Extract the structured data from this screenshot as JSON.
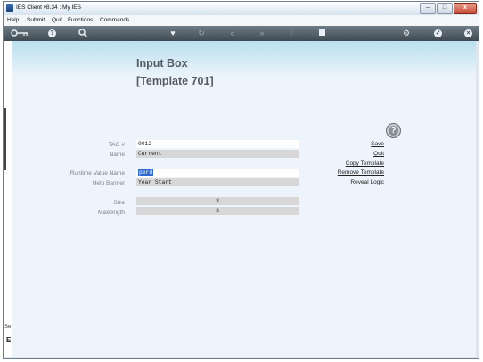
{
  "window": {
    "title": "IES Client v8.34 : My IES",
    "controls": {
      "minimize": "–",
      "maximize": "□",
      "close": "x"
    }
  },
  "menu": {
    "items": [
      "Help",
      "Submit",
      "Quit",
      "Functions",
      "Commands"
    ]
  },
  "toolbar": {
    "icons": [
      "key-icon",
      "help-icon",
      "search-icon",
      "heart-icon",
      "refresh-icon",
      "rewind-icon",
      "fast-forward-icon",
      "upload-icon",
      "stop-icon",
      "settings-icon",
      "check-icon",
      "close-icon"
    ]
  },
  "page": {
    "title": "Input Box",
    "subtitle": "[Template 701]"
  },
  "form": {
    "tag_label": "TAG #",
    "tag_value": "0012",
    "name_label": "Name",
    "name_value": "Current",
    "runtime_label": "Runtime Value Name",
    "runtime_value": "perd",
    "banner_label": "Help Banner",
    "banner_value": "Year Start",
    "size_label": "Size",
    "size_value": "3",
    "maxlength_label": "Maxlength",
    "maxlength_value": "3"
  },
  "actions": {
    "help": "?",
    "save": "Save",
    "quit": "Quit",
    "copy": "Copy Template",
    "remove": "Remove Template",
    "reveal": "Reveal Logic"
  },
  "sidebar": {
    "s_label": "Se",
    "e_label": "E"
  }
}
